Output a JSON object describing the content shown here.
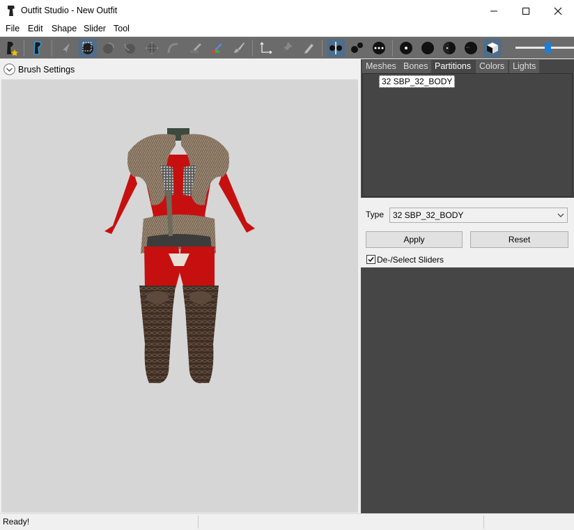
{
  "window": {
    "title": "Outfit Studio - New Outfit"
  },
  "menu": [
    "File",
    "Edit",
    "Shape",
    "Slider",
    "Tool"
  ],
  "toolbar": {
    "tools": [
      "load-reference-icon",
      "load-outfit-icon",
      "select-icon",
      "mask-icon",
      "inflate-icon",
      "deflate-icon",
      "move-icon",
      "smooth-icon",
      "undiff-icon",
      "weight-icon",
      "color-icon",
      "alpha-icon",
      "transform-icon",
      "pivot-icon",
      "vertex-edit-icon",
      "mirror-x-icon",
      "vertex-icon",
      "segment-icon",
      "point-icon",
      "circle-icon",
      "half-circle-icon",
      "dark-circle-icon",
      "wireframe-cube-icon"
    ],
    "slider_value": 0.55
  },
  "left": {
    "brush_settings_label": "Brush Settings"
  },
  "tabs": [
    "Meshes",
    "Bones",
    "Partitions",
    "Colors",
    "Lights"
  ],
  "selected_tab": "Partitions",
  "partitions": {
    "items": [
      "32 SBP_32_BODY"
    ]
  },
  "properties": {
    "type_label": "Type",
    "type_value": "32 SBP_32_BODY",
    "apply_label": "Apply",
    "reset_label": "Reset",
    "deselect_label": "De-/Select Sliders",
    "deselect_checked": true
  },
  "status": {
    "text": "Ready!"
  },
  "colors": {
    "viewport_bg": "#d6d6d6",
    "outfit_red": "#c61010",
    "panel_dark": "#464646",
    "active_tool": "#4e6d8c"
  }
}
